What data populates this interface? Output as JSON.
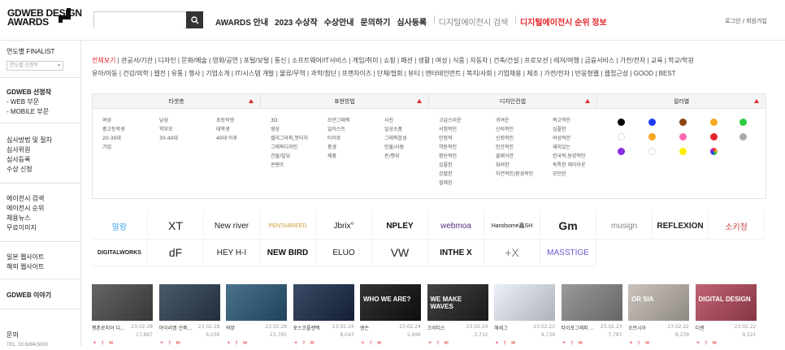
{
  "header": {
    "logo_line1": "GDWEB DESIGN",
    "logo_line2": "AWARDS",
    "search_placeholder": "",
    "nav": [
      {
        "label": "AWARDS 안내",
        "style": "bold"
      },
      {
        "label": "2023 수상작",
        "style": "bold"
      },
      {
        "label": "수상안내",
        "style": "bold"
      },
      {
        "label": "문의하기",
        "style": "bold"
      },
      {
        "label": "심사등록",
        "style": "bold"
      },
      {
        "label": "디지털에이전시 검색",
        "style": "gray"
      },
      {
        "label": "디지털에이전시 순위 정보",
        "style": "red"
      }
    ],
    "login": "로그인 / 회원가입"
  },
  "sidebar": {
    "finalist": "연도별 FINALIST",
    "select_placeholder": "연도별 선정작",
    "selected": "GDWEB 선정작",
    "web": "- WEB 부문",
    "mobile": "- MOBILE 부문",
    "process": "심사방법 및 절차",
    "judges": "심사위원",
    "register": "심사등록",
    "awarding": "수상 신청",
    "agency_search": "에이전시 검색",
    "agency_rank": "에이전시 순위",
    "jobs": "채용뉴스",
    "free_images": "무료이미지",
    "jp": "일본 웹사이트",
    "overseas": "해외 웹사이트",
    "story": "GDWEB 이야기",
    "contact": "문의",
    "tel": "TEL. 02.6394.5000"
  },
  "categories": [
    "전체보기",
    "관공서/기관",
    "디자인",
    "문화/예술",
    "영화/공연",
    "포털/보털",
    "통신",
    "소프트웨어/IT서비스",
    "게임/취미",
    "쇼핑",
    "패션",
    "생활",
    "여성",
    "식품",
    "자동차",
    "건축/건설",
    "프로모션",
    "레저/여행",
    "금융서비스",
    "가전/전자",
    "교육",
    "학교/학원",
    "유아/아동",
    "건강/의학",
    "웹진",
    "유통",
    "행사",
    "기업소개",
    "IT/시스템 개발",
    "물류/무역",
    "과학/첨단",
    "프랜차이즈",
    "단체/협회",
    "뷰티",
    "엔터테인먼트",
    "복지/사회",
    "기업채용",
    "제조",
    "가전/전자",
    "반응형웹",
    "웹접근성",
    "GOOD",
    "BEST"
  ],
  "filters": {
    "target": {
      "title": "타겟층",
      "cols": [
        [
          "여성",
          "중고등학생",
          "20-30대",
          "기업"
        ],
        [
          "남성",
          "학부모",
          "30-40대"
        ],
        [
          "초등학생",
          "대학생",
          "40대 이후"
        ]
      ]
    },
    "method": {
      "title": "표현방법",
      "cols": [
        [
          "3D",
          "영상",
          "캘리그라피,붓터치",
          "그래픽디자인",
          "건물/빌딩",
          "콘텐츠"
        ],
        [
          "모션그래픽",
          "일러스트",
          "타이포",
          "풍경",
          "제품"
        ],
        [
          "사진",
          "일상소품",
          "그래픽합성",
          "인물/사람",
          "손/행위"
        ]
      ]
    },
    "concept": {
      "title": "디자인컨셉",
      "cols": [
        [
          "고급스러운",
          "서정적인",
          "안정적",
          "역동적인",
          "첨단적인",
          "심플한",
          "강렬한",
          "절제된"
        ],
        [
          "귀여운",
          "신비적인",
          "신뢰적인",
          "인간적인",
          "클래식한",
          "화려한",
          "자연적인/환경적인"
        ],
        [
          "복고적인",
          "심플한",
          "여성적인",
          "재미있는",
          "한국적,동양적인",
          "독특한 레이아웃",
          "모던한"
        ]
      ]
    },
    "color": {
      "title": "컬러별",
      "dots": [
        "#000000",
        "#1a3cf0",
        "#8b4513",
        "#f5a623",
        "#2ecc40",
        "#ffffff",
        "#f5a623",
        "#ff69b4",
        "#e4252b",
        "#aaaaaa",
        "#8a2be2",
        "#ffffff",
        "#ffee00",
        "multi"
      ]
    }
  },
  "logos": [
    {
      "text": "말랑",
      "color": "#3aa0e8"
    },
    {
      "text": "XT",
      "color": "#222"
    },
    {
      "text": "New river",
      "color": "#222"
    },
    {
      "text": "PENTABREED",
      "color": "#c9a23a"
    },
    {
      "text": "Jbrix°",
      "color": "#222"
    },
    {
      "text": "NPLEY",
      "color": "#111"
    },
    {
      "text": "webmoa",
      "color": "#5a2d82"
    },
    {
      "text": "Handsome鑫SH",
      "color": "#222"
    },
    {
      "text": "Gm",
      "color": "#222"
    },
    {
      "text": "musign",
      "color": "#888"
    },
    {
      "text": "REFLEXION",
      "color": "#222"
    },
    {
      "text": "소키청",
      "color": "#c44"
    },
    {
      "text": "DIGITALWORKS",
      "color": "#222"
    },
    {
      "text": "dF",
      "color": "#222"
    },
    {
      "text": "HEY H-I",
      "color": "#222"
    },
    {
      "text": "NEW BIRD",
      "color": "#111"
    },
    {
      "text": "ELUO",
      "color": "#222"
    },
    {
      "text": "VW",
      "color": "#222"
    },
    {
      "text": "INTHE X",
      "color": "#111"
    },
    {
      "text": "+X",
      "color": "#888"
    },
    {
      "text": "MASSTIGE",
      "color": "#6a5acd"
    }
  ],
  "thumbs": [
    {
      "title": "평촌로지어 디...",
      "date": "23.02.28",
      "count": "17,887",
      "bg": "#4a4a4a",
      "caption": ""
    },
    {
      "title": "아이리엠 건축...",
      "date": "23.02.28",
      "count": "6,036",
      "bg": "#2c3e50",
      "caption": ""
    },
    {
      "title": "락앙",
      "date": "23.02.28",
      "count": "23,785",
      "bg": "#2a5a7a",
      "caption": ""
    },
    {
      "title": "포스코플랜텍",
      "date": "23.02.24",
      "count": "8,043",
      "bg": "#1a2a4a",
      "caption": ""
    },
    {
      "title": "엔슨",
      "date": "23.02.24",
      "count": "5,996",
      "bg": "#111111",
      "caption": "WHO WE ARE?"
    },
    {
      "title": "크리티스",
      "date": "23.02.24",
      "count": "3,732",
      "bg": "#222",
      "caption": "WE MAKE WAVES"
    },
    {
      "title": "헤세그",
      "date": "23.02.23",
      "count": "9,739",
      "bg": "#e8eef8",
      "caption": ""
    },
    {
      "title": "타이포그래피 ...",
      "date": "23.02.23",
      "count": "7,787",
      "bg": "#888",
      "caption": ""
    },
    {
      "title": "오르시아",
      "date": "23.02.22",
      "count": "8,239",
      "bg": "#c0b8b0",
      "caption": "OR SIA"
    },
    {
      "title": "디센",
      "date": "23.02.22",
      "count": "9,521",
      "bg": "#b5485a",
      "caption": "DIGITAL DESIGN"
    }
  ]
}
